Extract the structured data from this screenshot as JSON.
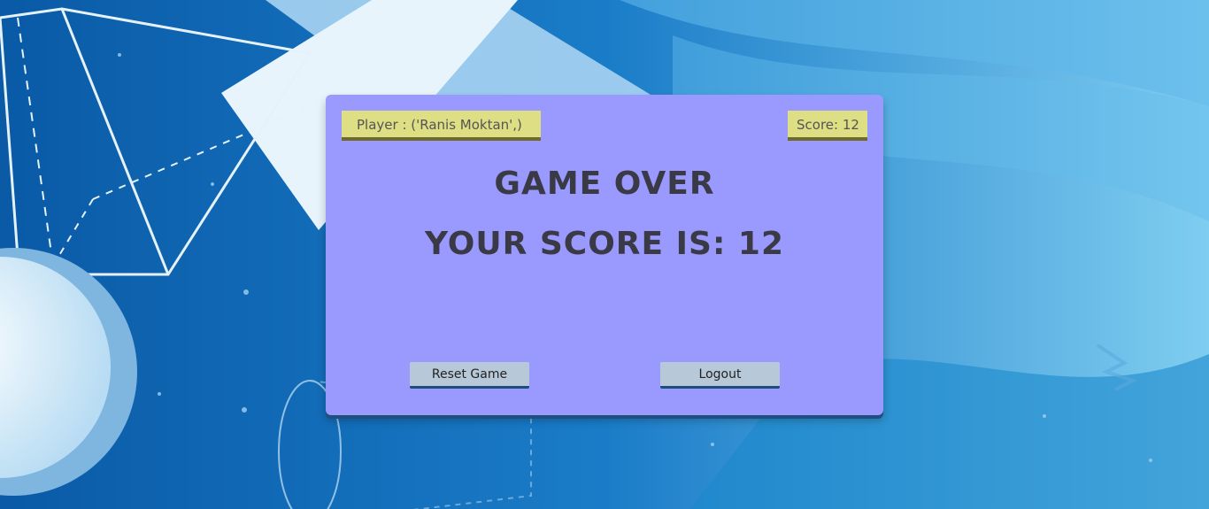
{
  "player": {
    "label": "Player : ('Ranis Moktan',)"
  },
  "score_tag": {
    "label": "Score: 12"
  },
  "game_over": {
    "title": "GAME OVER",
    "result": "YOUR SCORE IS: 12"
  },
  "buttons": {
    "reset": "Reset Game",
    "logout": "Logout"
  },
  "colors": {
    "card": "#9a99fd",
    "tag": "#dede84",
    "button": "#b7c9d9",
    "background": "#0a63b0"
  }
}
